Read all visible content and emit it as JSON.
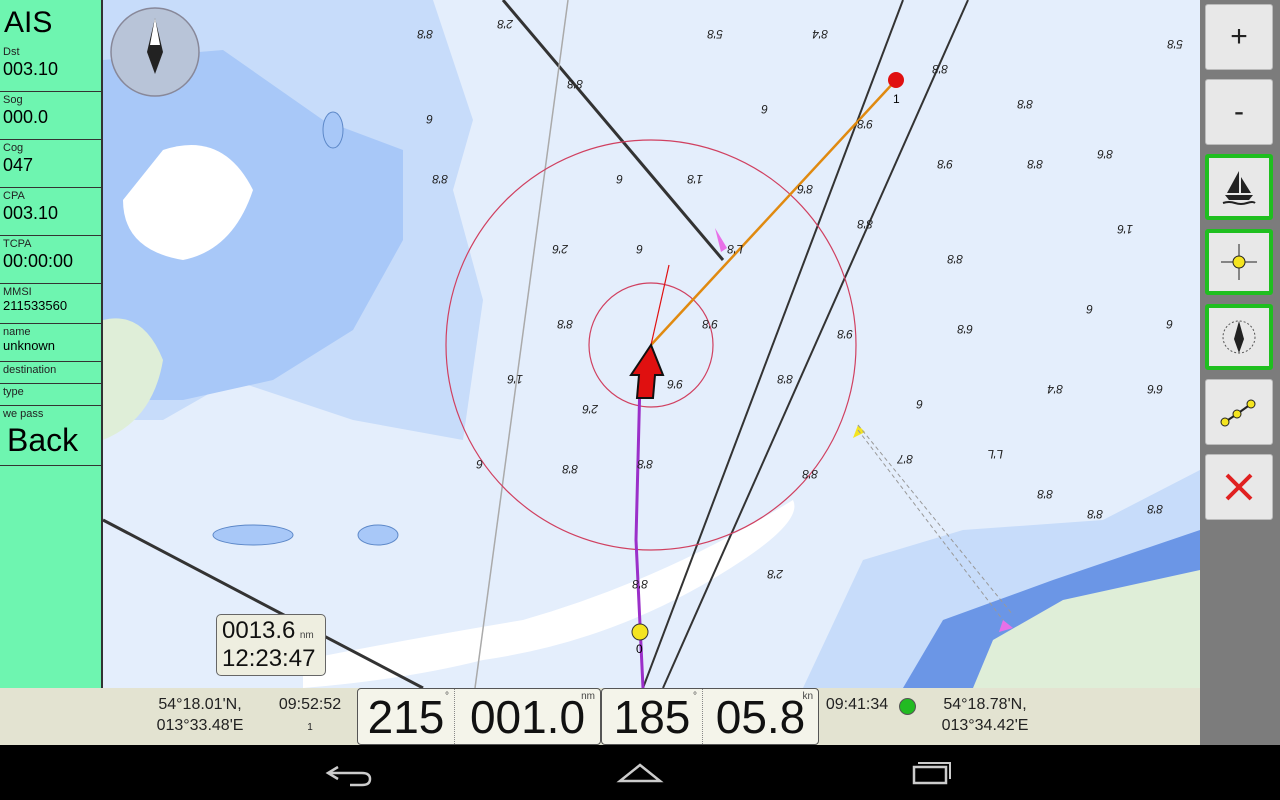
{
  "ais": {
    "title": "AIS",
    "fields": [
      {
        "label": "Dst",
        "value": "003.10"
      },
      {
        "label": "Sog",
        "value": "000.0"
      },
      {
        "label": "Cog",
        "value": "047"
      },
      {
        "label": "CPA",
        "value": "003.10"
      },
      {
        "label": "TCPA",
        "value": "00:00:00"
      },
      {
        "label": "MMSI",
        "value": "211533560"
      },
      {
        "label": "name",
        "value": "unknown"
      },
      {
        "label": "destination",
        "value": ""
      },
      {
        "label": "type",
        "value": ""
      },
      {
        "label": "we pass",
        "value": ""
      }
    ],
    "back_label": "Back"
  },
  "odometer": {
    "distance": "0013.6",
    "unit": "nm",
    "time": "12:23:47"
  },
  "map": {
    "depth_labels": [
      "8'8",
      "2'8",
      "5'8",
      "8'4",
      "8'8",
      "5'8",
      "6",
      "8'8",
      "6",
      "9'8",
      "8'8",
      "8'6",
      "8'8",
      "6",
      "1'8",
      "8'6",
      "9'8",
      "8'8",
      "1'6",
      "2'6",
      "6",
      "L'8",
      "8'8",
      "8'8",
      "6",
      "8'8",
      "9'8",
      "9'8",
      "6'8",
      "6",
      "1'6",
      "2'6",
      "9'6",
      "8'8",
      "6",
      "8'4",
      "6'6",
      "6",
      "8'8",
      "8'8",
      "8'8",
      "8'7",
      "L'L",
      "8'8",
      "8'8",
      "8'8",
      "8'8",
      "2'8"
    ],
    "marker_labels": [
      "1",
      "0"
    ],
    "colors": {
      "sea_shallow": "#a8c8f8",
      "sea_mid": "#c7dcfa",
      "sea_deep": "#e4eefc",
      "land": "#ffffff",
      "coast_land": "#dfeed8",
      "deep_channel": "#6b96e6"
    }
  },
  "toolbar": {
    "zoom_in_label": "+",
    "zoom_out_label": "-",
    "buttons": [
      "zoom-in",
      "zoom-out",
      "boat-icon",
      "crosshair-icon",
      "compass-icon",
      "route-icon",
      "close-icon"
    ]
  },
  "statusbar": {
    "left_pos_lat": "54°18.01'N,",
    "left_pos_lon": "013°33.48'E",
    "left_time": "09:52:52",
    "left_time_sub": "1",
    "bearing": "215",
    "bearing_unit": "°",
    "distance": "001.0",
    "distance_unit": "nm",
    "course": "185",
    "course_unit": "°",
    "speed": "05.8",
    "speed_unit": "kn",
    "gps_time": "09:41:34",
    "gps_status_color": "#22bb22",
    "right_pos_lat": "54°18.78'N,",
    "right_pos_lon": "013°34.42'E"
  }
}
